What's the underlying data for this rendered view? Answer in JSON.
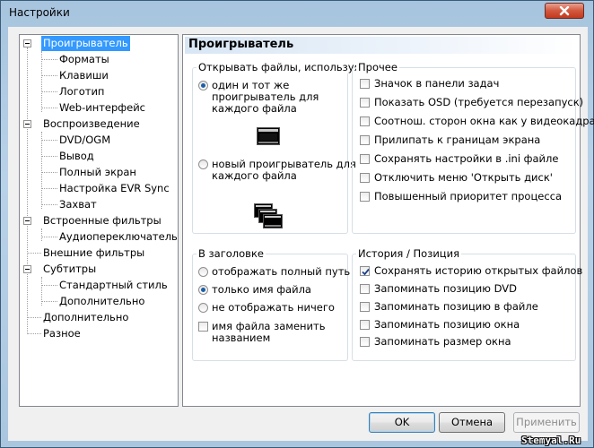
{
  "window": {
    "title": "Настройки"
  },
  "tree": {
    "items": [
      "Проигрыватель",
      "Форматы",
      "Клавиши",
      "Логотип",
      "Web-интерфейс",
      "Воспроизведение",
      "DVD/OGM",
      "Вывод",
      "Полный экран",
      "Настройка EVR Sync",
      "Захват",
      "Встроенные фильтры",
      "Аудиопереключатель",
      "Внешние фильтры",
      "Субтитры",
      "Стандартный стиль",
      "Дополнительно",
      "Дополнительно",
      "Разное"
    ]
  },
  "panel": {
    "title": "Проигрыватель"
  },
  "open_files": {
    "label": "Открывать файлы, используя",
    "option1": [
      "один и тот же",
      "проигрыватель для",
      "каждого файла"
    ],
    "option2": [
      "новый проигрыватель для",
      "каждого файла"
    ],
    "selected": 0
  },
  "other": {
    "label": "Прочее",
    "items": [
      {
        "label": "Значок в панели задач",
        "checked": false
      },
      {
        "label": "Показать OSD (требуется перезапуск)",
        "checked": false
      },
      {
        "label": "Соотнош. сторон окна как у видеокадра",
        "checked": false
      },
      {
        "label": "Прилипать к границам экрана",
        "checked": false
      },
      {
        "label": "Сохранять настройки в .ini файле",
        "checked": false
      },
      {
        "label": "Отключить меню 'Открыть диск'",
        "checked": false
      },
      {
        "label": "Повышенный приоритет процесса",
        "checked": false
      }
    ]
  },
  "caption": {
    "label": "В заголовке",
    "options": [
      "отображать полный путь",
      "только имя файла",
      "не отображать ничего"
    ],
    "selected": 1,
    "replace": [
      "имя файла заменить",
      "названием"
    ],
    "replace_checked": false
  },
  "history": {
    "label": "История / Позиция",
    "items": [
      {
        "label": "Сохранять историю открытых файлов",
        "checked": true
      },
      {
        "label": "Запоминать позицию DVD",
        "checked": false
      },
      {
        "label": "Запоминать позицию в файле",
        "checked": false
      },
      {
        "label": "Запоминать позицию окна",
        "checked": false
      },
      {
        "label": "Запоминать размер окна",
        "checked": false
      }
    ]
  },
  "buttons": {
    "ok": "OK",
    "cancel": "Отмена",
    "apply": "Применить"
  },
  "watermark": "Stemyal.Ru",
  "colors": {
    "selection": "#3399ff",
    "accent": "#1d5ea8",
    "close": "#c2391e"
  }
}
